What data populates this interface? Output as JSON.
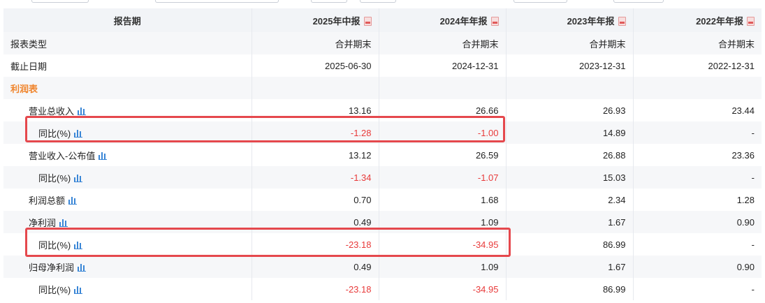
{
  "header": {
    "label": "报告期",
    "periods": [
      "2025年中报",
      "2024年年报",
      "2023年年报",
      "2022年年报"
    ]
  },
  "rows": [
    {
      "label": "报表类型",
      "values": [
        "合并期末",
        "合并期末",
        "合并期末",
        "合并期末"
      ]
    },
    {
      "label": "截止日期",
      "values": [
        "2025-06-30",
        "2024-12-31",
        "2023-12-31",
        "2022-12-31"
      ]
    },
    {
      "label": "利润表",
      "values": [
        "",
        "",
        "",
        ""
      ]
    },
    {
      "label": "营业总收入",
      "values": [
        "13.16",
        "26.66",
        "26.93",
        "23.44"
      ]
    },
    {
      "label": "同比(%)",
      "values": [
        "-1.28",
        "-1.00",
        "14.89",
        "-"
      ]
    },
    {
      "label": "营业收入-公布值",
      "values": [
        "13.12",
        "26.59",
        "26.88",
        "23.36"
      ]
    },
    {
      "label": "同比(%)",
      "values": [
        "-1.34",
        "-1.07",
        "15.03",
        "-"
      ]
    },
    {
      "label": "利润总额",
      "values": [
        "0.70",
        "1.68",
        "2.34",
        "1.28"
      ]
    },
    {
      "label": "净利润",
      "values": [
        "0.49",
        "1.09",
        "1.67",
        "0.90"
      ]
    },
    {
      "label": "同比(%)",
      "values": [
        "-23.18",
        "-34.95",
        "86.99",
        "-"
      ]
    },
    {
      "label": "归母净利润",
      "values": [
        "0.49",
        "1.09",
        "1.67",
        "0.90"
      ]
    },
    {
      "label": "同比(%)",
      "values": [
        "-23.18",
        "-34.95",
        "86.99",
        "-"
      ]
    }
  ],
  "colors": {
    "negative": "#e83a3a",
    "section": "#f0852d",
    "highlight": "#e5484d",
    "chart_icon": "#3a86d6"
  }
}
